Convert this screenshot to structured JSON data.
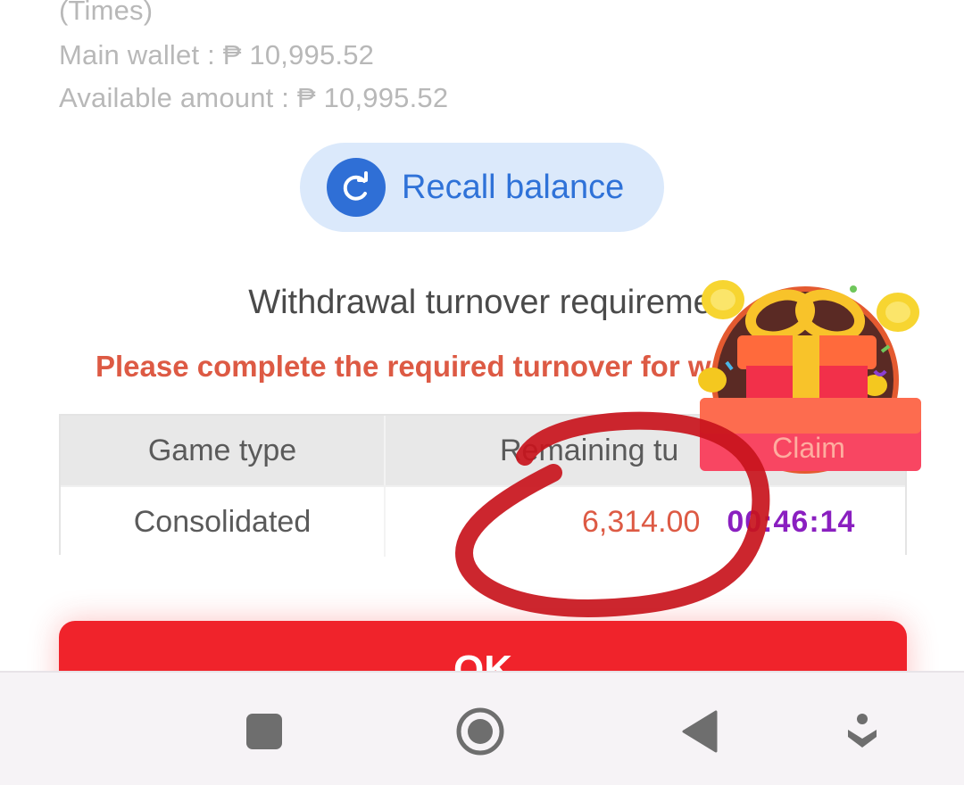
{
  "wallet": {
    "times_label": "(Times)",
    "main_wallet": "Main wallet : ₱ 10,995.52",
    "available_amount": "Available amount : ₱ 10,995.52"
  },
  "recall": {
    "label": "Recall balance",
    "icon": "refresh-icon"
  },
  "turnover": {
    "title": "Withdrawal turnover requireme",
    "warning": "Please complete the required turnover for w",
    "table": {
      "headers": [
        "Game type",
        "Remaining tu"
      ],
      "rows": [
        {
          "game_type": "Consolidated",
          "remaining": "6,314.00"
        }
      ]
    }
  },
  "claim_popup": {
    "label": "Claim",
    "timer": "00:46:14",
    "icon": "gift-icon"
  },
  "ok_button": {
    "label": "OK"
  },
  "nav_bar": {
    "items": [
      "recent-apps-icon",
      "home-icon",
      "back-icon",
      "accessibility-icon"
    ]
  },
  "colors": {
    "accent_blue": "#2f72d8",
    "warning_red": "#dd5a44",
    "ok_red": "#f0232b",
    "timer_purple": "#8a1fc0",
    "annotation_red": "#c8141c"
  }
}
